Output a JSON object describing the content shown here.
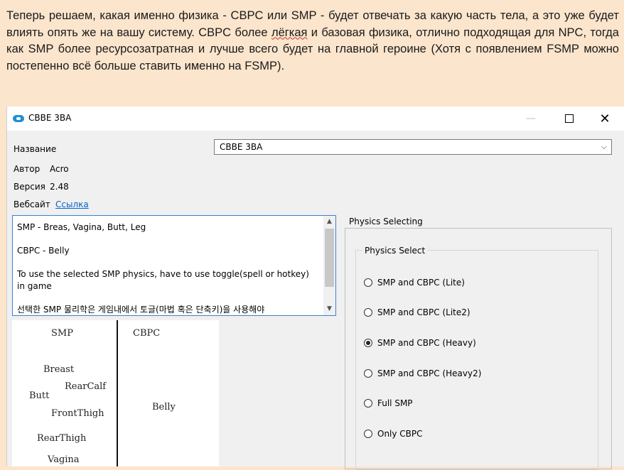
{
  "post": {
    "text_before": "Теперь решаем, какая именно физика - CBPC или SMP - будет отвечать за какую часть тела, а это уже будет влиять опять же на вашу систему. CBPC более ",
    "spell_word": "лёгкая",
    "text_after": " и базовая физика, отлично подходящая для NPC, тогда как SMP более ресурсозатратная и лучше всего будет на главной героине (Хотя с появлением FSMP можно постепенно всё больше ставить именно на FSMP)."
  },
  "window": {
    "title": "CBBE 3BA",
    "min_symbol": "—",
    "close_symbol": "✕"
  },
  "info": {
    "name_label": "Название",
    "author_label": "Автор",
    "author_value": "Acro",
    "version_label": "Версия",
    "version_value": "2.48",
    "website_label": "Вебсайт",
    "website_link": "Ссылка"
  },
  "combo": {
    "value": "CBBE 3BA",
    "arrow": "⌵"
  },
  "description": {
    "lines": [
      "SMP - Breas, Vagina, Butt, Leg",
      "CBPC - Belly",
      "To use the selected SMP physics, have to use toggle(spell or hotkey) in game",
      "선택한 SMP 물리학은 게임내에서 토글(마법 혹은 단축키)을 사용해야"
    ],
    "scroll_up": "▲",
    "scroll_down": "▼"
  },
  "diagram": {
    "left_header": "SMP",
    "right_header": "CBPC",
    "left_items": [
      "Breast",
      "RearCalf",
      "Butt",
      "FrontThigh",
      "RearThigh",
      "Vagina"
    ],
    "right_items": [
      "Belly"
    ]
  },
  "physics": {
    "outer_title": "Physics Selecting",
    "inner_title": "Physics Select",
    "options": [
      {
        "label": "SMP and CBPC (Lite)",
        "checked": false
      },
      {
        "label": "SMP and CBPC (Lite2)",
        "checked": false
      },
      {
        "label": "SMP and CBPC (Heavy)",
        "checked": true
      },
      {
        "label": "SMP and CBPC (Heavy2)",
        "checked": false
      },
      {
        "label": "Full SMP",
        "checked": false
      },
      {
        "label": "Only CBPC",
        "checked": false
      }
    ]
  },
  "colors": {
    "post_background": "#fbe5cc",
    "link": "#0066cc",
    "focus_border": "#3c7fd2",
    "app_icon": "#1f8fd6"
  }
}
